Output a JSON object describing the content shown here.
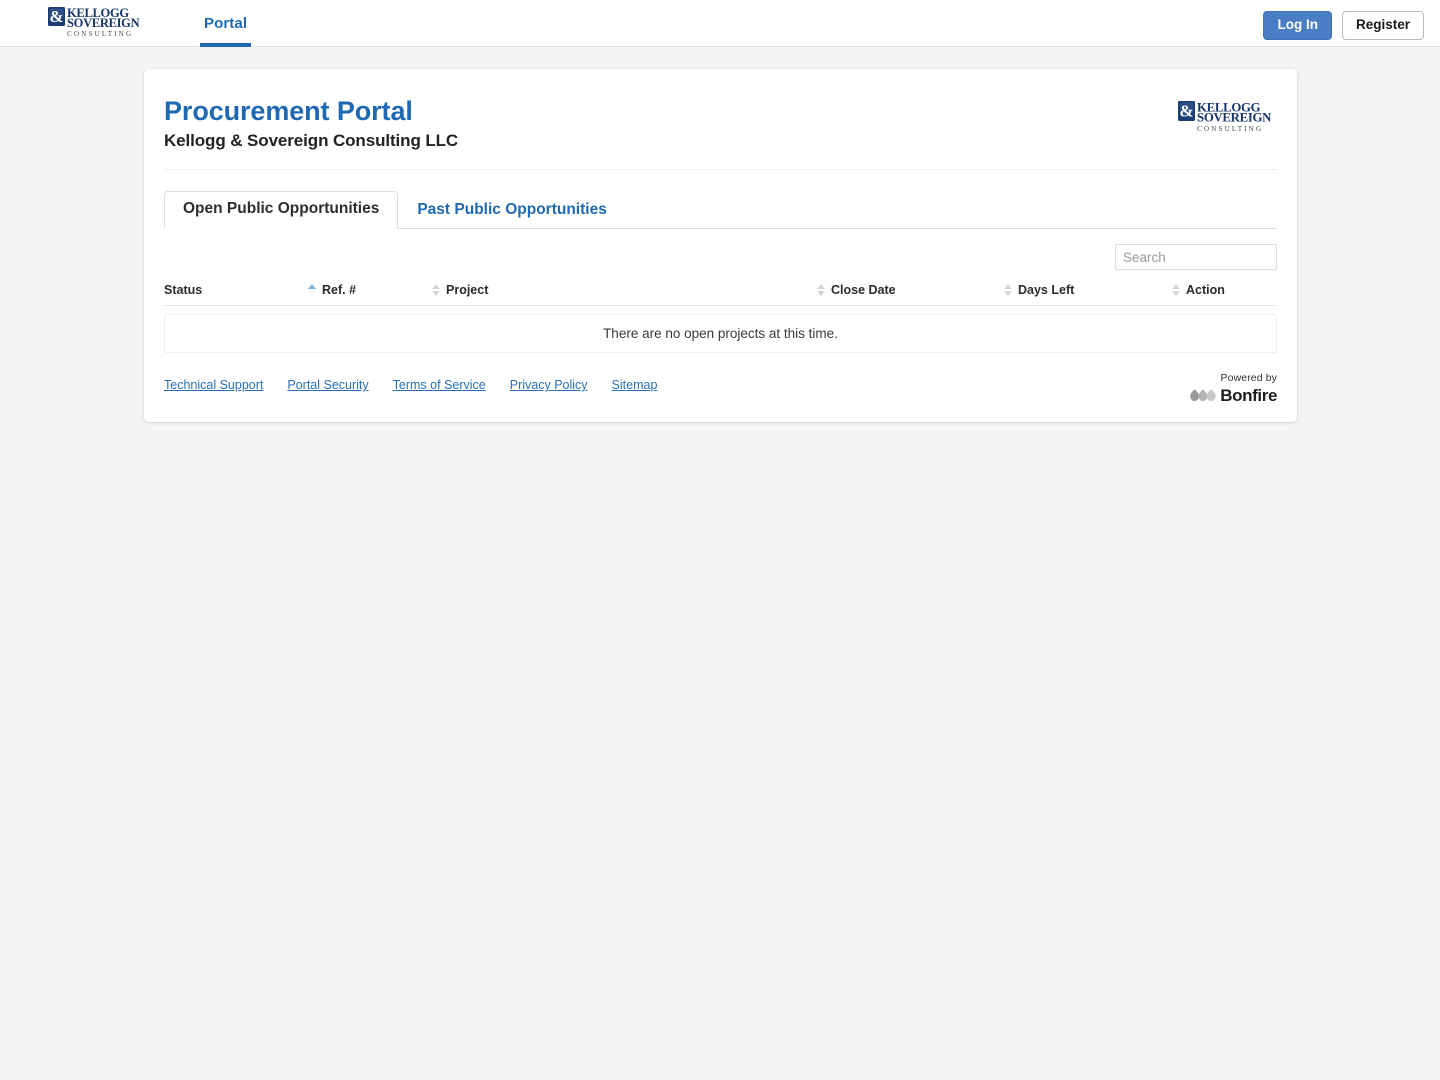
{
  "topnav": {
    "logo_alt": "Kellogg & Sovereign Consulting",
    "logo_line1": "KELLOGG",
    "logo_line2": "SOVEREIGN",
    "logo_line3": "C O N S U L T I N G",
    "logo_mark": "&",
    "links": [
      {
        "label": "Portal",
        "active": true
      }
    ],
    "login_label": "Log In",
    "register_label": "Register"
  },
  "card": {
    "title": "Procurement Portal",
    "subtitle": "Kellogg & Sovereign Consulting LLC",
    "logo_line1": "KELLOGG",
    "logo_line2": "SOVEREIGN",
    "logo_line3": "C O N S U L T I N G",
    "logo_mark": "&"
  },
  "tabs": [
    {
      "label": "Open Public Opportunities",
      "active": true
    },
    {
      "label": "Past Public Opportunities",
      "active": false
    }
  ],
  "search": {
    "value": "",
    "placeholder": "Search"
  },
  "table": {
    "columns": [
      {
        "label": "Status",
        "sort": "asc"
      },
      {
        "label": "Ref. #",
        "sort": "none"
      },
      {
        "label": "Project",
        "sort": "none"
      },
      {
        "label": "Close Date",
        "sort": "none"
      },
      {
        "label": "Days Left",
        "sort": "none"
      },
      {
        "label": "Action",
        "sort": "none"
      }
    ],
    "rows": [],
    "empty_message": "There are no open projects at this time."
  },
  "footer": {
    "links": [
      {
        "label": "Technical Support"
      },
      {
        "label": "Portal Security"
      },
      {
        "label": "Terms of Service"
      },
      {
        "label": "Privacy Policy"
      },
      {
        "label": "Sitemap"
      }
    ],
    "powered_by_label": "Powered by",
    "powered_by_brand": "Bonfire"
  },
  "colors": {
    "accent_blue": "#1f69b3",
    "button_blue": "#4a7ec4",
    "link_blue": "#2a6fb5",
    "page_background": "#f4f4f4",
    "card_background": "#ffffff",
    "sort_active": "#7fb2d6"
  }
}
